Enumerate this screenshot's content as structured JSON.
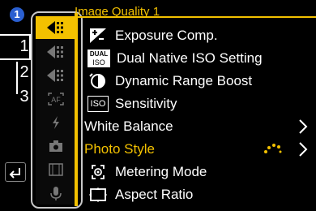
{
  "page_badge": "1",
  "tabs": [
    "1",
    "2",
    "3"
  ],
  "header": {
    "title": "Image Quality 1"
  },
  "menu": [
    {
      "label": "Exposure Comp.",
      "icon": "exposure-comp-icon"
    },
    {
      "label": "Dual Native ISO Setting",
      "icon": "dual-iso-icon",
      "icon_text_top": "DUAL",
      "icon_text_bottom": "ISO"
    },
    {
      "label": "Dynamic Range Boost",
      "icon": "dynamic-range-icon"
    },
    {
      "label": "Sensitivity",
      "icon": "iso-icon",
      "icon_text": "ISO"
    },
    {
      "label": "White Balance",
      "icon": "",
      "has_submenu": true
    },
    {
      "label": "Photo Style",
      "icon": "",
      "has_submenu": true,
      "active": true,
      "value_icon": "photo-style-sparkle-icon"
    },
    {
      "label": "Metering Mode",
      "icon": "metering-icon"
    },
    {
      "label": "Aspect Ratio",
      "icon": "aspect-ratio-icon"
    }
  ],
  "category_icons": [
    {
      "name": "image-quality-icon",
      "selected": true
    },
    {
      "name": "image-quality-2-icon",
      "selected": false
    },
    {
      "name": "image-quality-3-icon",
      "selected": false
    },
    {
      "name": "focus-icon",
      "text": "AF",
      "selected": false
    },
    {
      "name": "flash-icon",
      "selected": false
    },
    {
      "name": "camera-icon",
      "selected": false
    },
    {
      "name": "film-icon",
      "selected": false
    },
    {
      "name": "microphone-icon",
      "selected": false
    }
  ],
  "colors": {
    "accent": "#f3c100",
    "badge": "#2a5fd0",
    "background": "#000000"
  }
}
